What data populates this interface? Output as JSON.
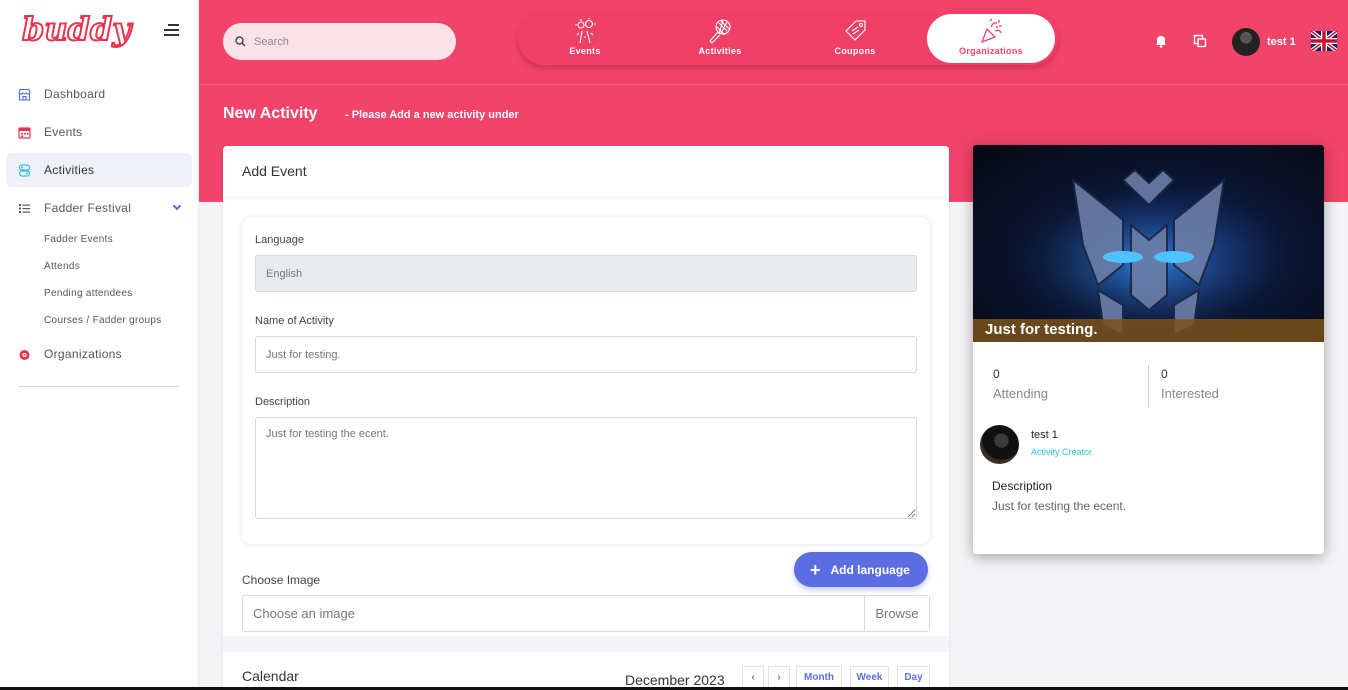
{
  "app": {
    "logo": "buddy"
  },
  "search": {
    "placeholder": "Search"
  },
  "sidebar": {
    "items": [
      {
        "label": "Dashboard",
        "icon": "store-icon"
      },
      {
        "label": "Events",
        "icon": "calendar-icon"
      },
      {
        "label": "Activities",
        "icon": "activities-icon"
      },
      {
        "label": "Fadder Festival",
        "icon": "list-icon"
      },
      {
        "label": "Organizations",
        "icon": "organization-icon"
      }
    ],
    "subitems": [
      "Fadder Events",
      "Attends",
      "Pending attendees",
      "Courses / Fadder groups"
    ]
  },
  "tabs": [
    "Events",
    "Activities",
    "Coupons",
    "Organizations"
  ],
  "header": {
    "username": "test 1"
  },
  "page": {
    "title": "New Activity",
    "subtitle": "- Please Add a new activity under"
  },
  "form": {
    "title": "Add Event",
    "language_label": "Language",
    "language_value": "English",
    "name_label": "Name of Activity",
    "name_placeholder": "Just for testing.",
    "desc_label": "Description",
    "desc_placeholder": "Just for testing the ecent.",
    "add_language": "Add language",
    "image_label": "Choose Image",
    "image_placeholder": "Choose an image",
    "browse": "Browse"
  },
  "calendar": {
    "title": "Calendar",
    "month": "December 2023",
    "prev": "‹",
    "next": "›",
    "views": [
      "Month",
      "Week",
      "Day"
    ]
  },
  "preview": {
    "caption": "Just for testing.",
    "attending_count": "0",
    "attending_label": "Attending",
    "interested_count": "0",
    "interested_label": "Interested",
    "creator_name": "test 1",
    "creator_role": "Activity Creator",
    "desc_heading": "Description",
    "desc_text": "Just for testing the ecent."
  },
  "colors": {
    "brand": "#f2436a",
    "accent": "#5b6ee1",
    "role": "#2ec5d9"
  }
}
